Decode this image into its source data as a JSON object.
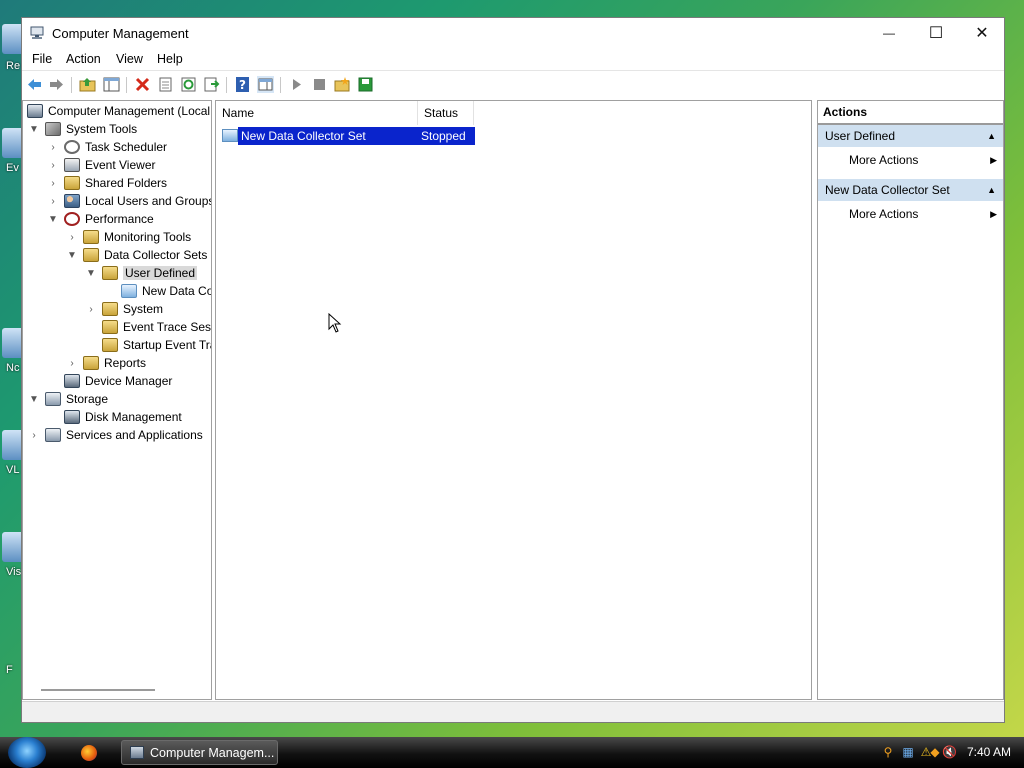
{
  "desktop": {
    "labels": [
      "Re",
      "Ev",
      "Nc",
      "VL",
      "Vis",
      "F"
    ]
  },
  "window": {
    "title": "Computer Management",
    "controls": {
      "minimize": "—",
      "maximize": "☐",
      "close": "✕"
    }
  },
  "menu": {
    "items": [
      "File",
      "Action",
      "View",
      "Help"
    ]
  },
  "tree": {
    "root": "Computer Management (Local",
    "system_tools": "System Tools",
    "task_scheduler": "Task Scheduler",
    "event_viewer": "Event Viewer",
    "shared_folders": "Shared Folders",
    "local_users": "Local Users and Groups",
    "performance": "Performance",
    "monitoring_tools": "Monitoring Tools",
    "data_collector_sets": "Data Collector Sets",
    "user_defined": "User Defined",
    "new_data_collector": "New Data Co",
    "system": "System",
    "event_trace": "Event Trace Sess",
    "startup_event": "Startup Event Tra",
    "reports": "Reports",
    "device_manager": "Device Manager",
    "storage": "Storage",
    "disk_management": "Disk Management",
    "services_apps": "Services and Applications"
  },
  "list": {
    "columns": [
      "Name",
      "Status"
    ],
    "rows": [
      {
        "name": "New Data Collector Set",
        "status": "Stopped"
      }
    ]
  },
  "actions": {
    "title": "Actions",
    "sections": [
      {
        "header": "User Defined",
        "item": "More Actions"
      },
      {
        "header": "New Data Collector Set",
        "item": "More Actions"
      }
    ]
  },
  "taskbar": {
    "task_label": "Computer Managem...",
    "clock": "7:40 AM"
  }
}
